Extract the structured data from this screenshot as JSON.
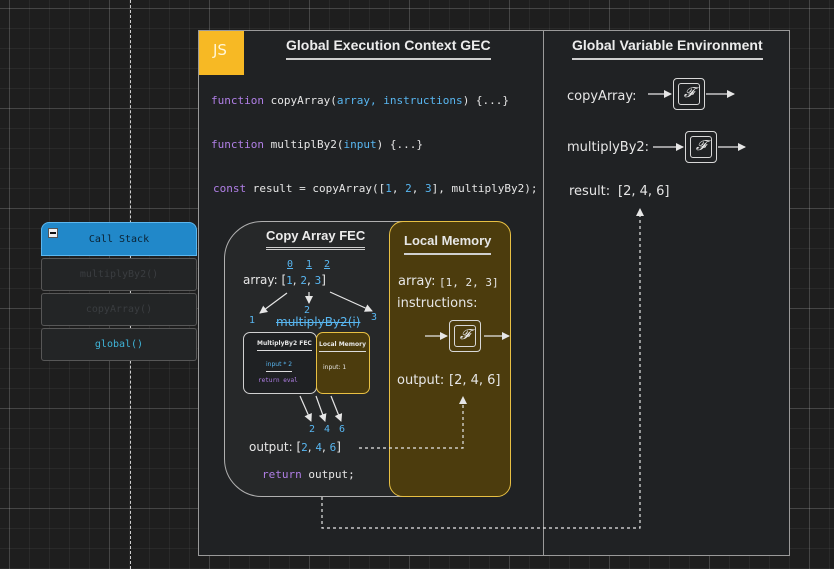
{
  "call_stack": {
    "title": "Call Stack",
    "items": [
      "multiplyBy2()",
      "copyArray()",
      "global()"
    ]
  },
  "js_badge": "JS",
  "gec": {
    "title": "Global Execution Context GEC",
    "line1": {
      "kw": "function",
      "name": " copyArray(",
      "params": "array, instructions",
      "rest": ") {...}"
    },
    "line2": {
      "kw": "function",
      "name": " multiplBy2(",
      "params": "input",
      "rest": ") {...}"
    },
    "line3": {
      "kw": "const",
      "pre": " result = copyArray([",
      "n1": "1",
      "n2": "2",
      "n3": "3",
      "post": "], multiplyBy2);"
    }
  },
  "gve": {
    "title": "Global Variable Environment",
    "rows": [
      {
        "label": "copyArray:",
        "glyph": "𝓕"
      },
      {
        "label": "multiplyBy2:",
        "glyph": "𝓕"
      }
    ],
    "result_label": "result:",
    "result_value": "[2, 4, 6]"
  },
  "fec": {
    "title": "Copy Array FEC",
    "indices": [
      "0",
      "1",
      "2"
    ],
    "array_label": "array: [",
    "array_values": [
      "1",
      "2",
      "3"
    ],
    "array_close": "]",
    "mapped": [
      "1",
      "2",
      "3"
    ],
    "call_label": "multiplyBy2(i)",
    "sub_fec_title": "MultiplyBy2 FEC",
    "sub_fec_expr": "input * 2",
    "sub_fec_return": "return eval",
    "sub_lm_title": "Local Memory",
    "sub_lm_value": "input: 1",
    "results": [
      "2",
      "4",
      "6"
    ],
    "output_label": "output: [",
    "output_values": [
      "2",
      "4",
      "6"
    ],
    "output_close": "]",
    "return_kw": "return",
    "return_val": " output;"
  },
  "local_memory": {
    "title": "Local Memory",
    "array_label": "array:",
    "array_value": "[1, 2, 3]",
    "instructions_label": "instructions:",
    "glyph": "𝓕",
    "output_label": "output:",
    "output_value": "[2, 4, 6]"
  },
  "colors": {
    "accent_yellow": "#f7b924",
    "call_stack_blue": "#2188c9",
    "keyword_purple": "#b07fe6",
    "value_cyan": "#58b6f0",
    "local_memory_fill": "#4c3c0d"
  }
}
